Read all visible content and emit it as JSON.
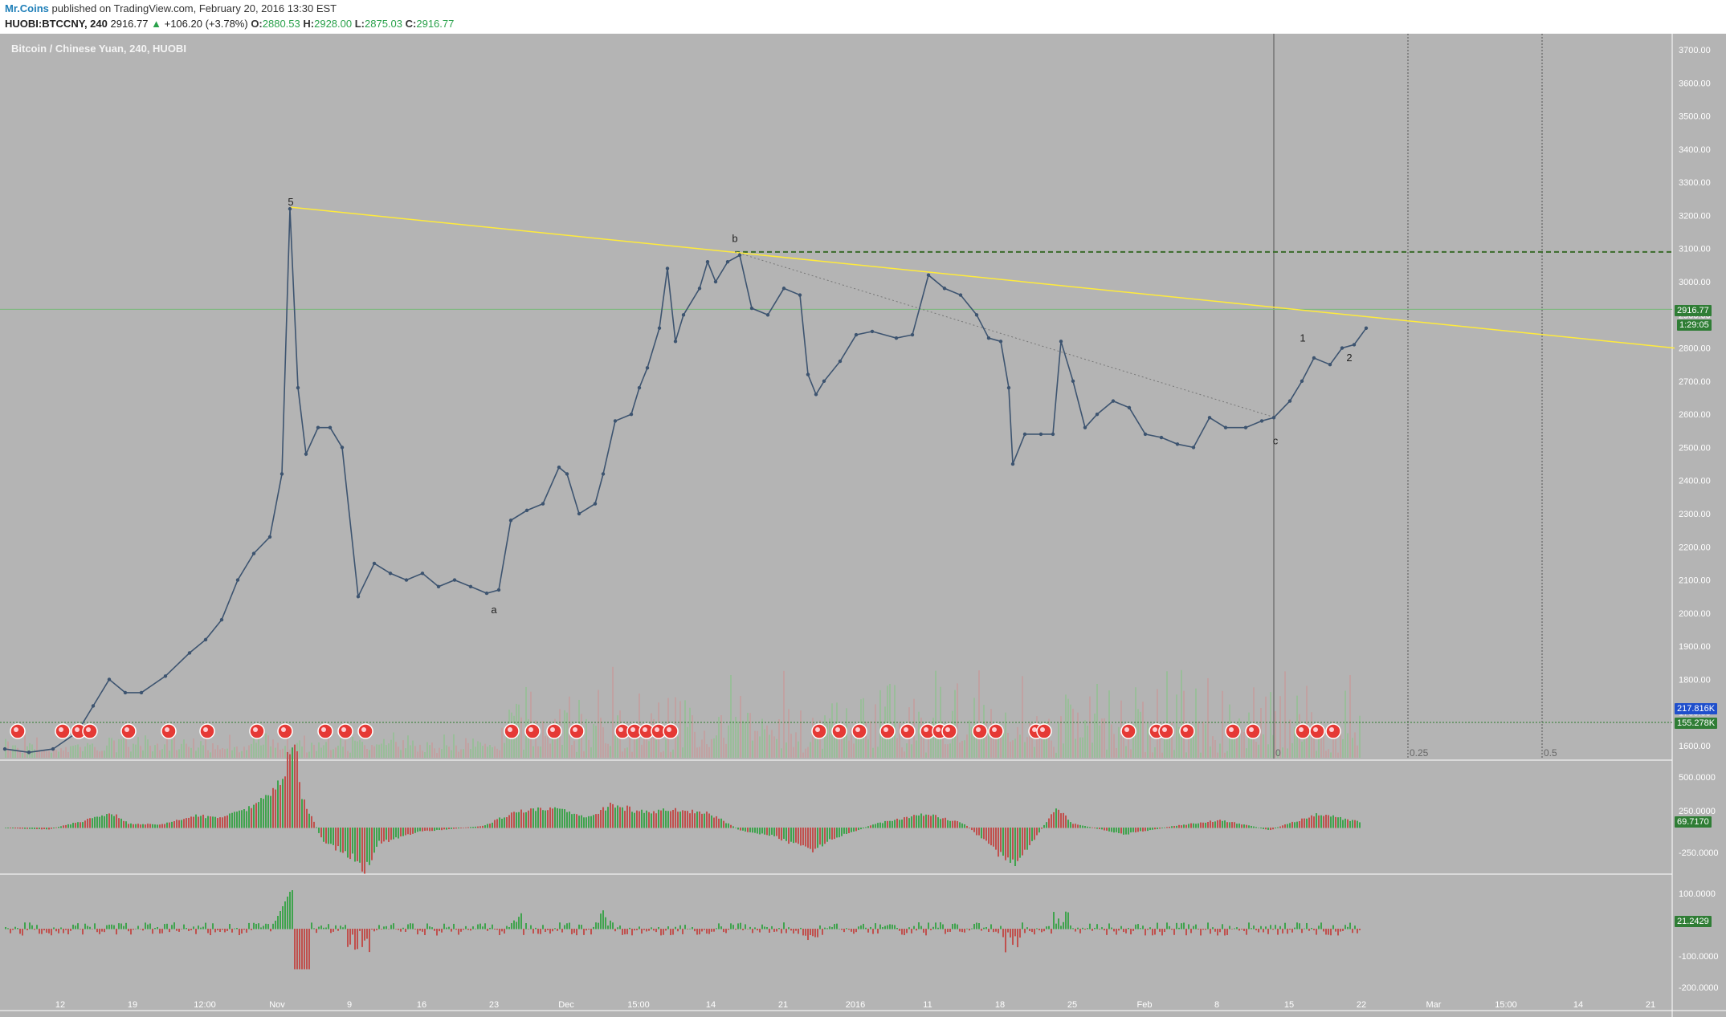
{
  "header": {
    "author": "Mr.Coins",
    "published_text": "published on TradingView.com, February 20, 2016 13:30 EST",
    "symbol": "HUOBI:BTCCNY, 240",
    "last": "2916.77",
    "change": "+106.20 (+3.78%)",
    "o_label": "O:",
    "o_value": "2880.53",
    "h_label": "H:",
    "h_value": "2928.00",
    "l_label": "L:",
    "l_value": "2875.03",
    "c_label": "C:",
    "c_value": "2916.77"
  },
  "panel_title": "Bitcoin / Chinese Yuan, 240, HUOBI",
  "tags": {
    "last_price": "2916.77",
    "countdown": "1:29:05",
    "vol_ma": "217.816K",
    "vol": "155.278K",
    "ind1": "69.7170",
    "ind2": "21.2429"
  },
  "colors": {
    "background": "#b4b4b4",
    "price_line": "#3d5470",
    "trendline": "#ffeb3b",
    "resistance": "#3a6b2a",
    "up": "#4caf50",
    "down": "#c0504d"
  },
  "chart_data": {
    "type": "line",
    "title": "Bitcoin / Chinese Yuan, 240, HUOBI",
    "y_range": [
      1570,
      3760
    ],
    "y_ticks": [
      "3700.00",
      "3600.00",
      "3500.00",
      "3400.00",
      "3300.00",
      "3200.00",
      "3100.00",
      "3000.00",
      "2900.00",
      "2800.00",
      "2700.00",
      "2600.00",
      "2500.00",
      "2400.00",
      "2300.00",
      "2200.00",
      "2100.00",
      "2000.00",
      "1900.00",
      "1800.00",
      "1700.00",
      "1600.00"
    ],
    "x_ticks": [
      "12",
      "19",
      "12:00",
      "Nov",
      "9",
      "16",
      "23",
      "Dec",
      "15:00",
      "14",
      "21",
      "2016",
      "11",
      "18",
      "25",
      "Feb",
      "8",
      "15",
      "22",
      "Mar",
      "15:00",
      "14",
      "21"
    ],
    "series": [
      {
        "points": [
          [
            0,
            1590
          ],
          [
            30,
            1580
          ],
          [
            60,
            1590
          ],
          [
            90,
            1640
          ],
          [
            110,
            1720
          ],
          [
            130,
            1800
          ],
          [
            150,
            1760
          ],
          [
            170,
            1760
          ],
          [
            200,
            1810
          ],
          [
            230,
            1880
          ],
          [
            250,
            1920
          ],
          [
            270,
            1980
          ],
          [
            290,
            2100
          ],
          [
            310,
            2180
          ],
          [
            330,
            2230
          ],
          [
            345,
            2420
          ],
          [
            355,
            3220
          ],
          [
            365,
            2680
          ],
          [
            375,
            2480
          ],
          [
            390,
            2560
          ],
          [
            405,
            2560
          ],
          [
            420,
            2500
          ],
          [
            440,
            2050
          ],
          [
            460,
            2150
          ],
          [
            480,
            2120
          ],
          [
            500,
            2100
          ],
          [
            520,
            2120
          ],
          [
            540,
            2080
          ],
          [
            560,
            2100
          ],
          [
            580,
            2080
          ],
          [
            600,
            2060
          ],
          [
            615,
            2070
          ],
          [
            630,
            2280
          ],
          [
            650,
            2310
          ],
          [
            670,
            2330
          ],
          [
            690,
            2440
          ],
          [
            700,
            2420
          ],
          [
            715,
            2300
          ],
          [
            735,
            2330
          ],
          [
            745,
            2420
          ],
          [
            760,
            2580
          ],
          [
            780,
            2600
          ],
          [
            790,
            2680
          ],
          [
            800,
            2740
          ],
          [
            815,
            2860
          ],
          [
            825,
            3040
          ],
          [
            835,
            2820
          ],
          [
            845,
            2900
          ],
          [
            865,
            2980
          ],
          [
            875,
            3060
          ],
          [
            885,
            3000
          ],
          [
            900,
            3060
          ],
          [
            915,
            3080
          ],
          [
            930,
            2920
          ],
          [
            950,
            2900
          ],
          [
            970,
            2980
          ],
          [
            990,
            2960
          ],
          [
            1000,
            2720
          ],
          [
            1010,
            2660
          ],
          [
            1020,
            2700
          ],
          [
            1040,
            2760
          ],
          [
            1060,
            2840
          ],
          [
            1080,
            2850
          ],
          [
            1110,
            2830
          ],
          [
            1130,
            2840
          ],
          [
            1150,
            3020
          ],
          [
            1170,
            2980
          ],
          [
            1190,
            2960
          ],
          [
            1210,
            2900
          ],
          [
            1225,
            2830
          ],
          [
            1240,
            2820
          ],
          [
            1250,
            2680
          ],
          [
            1255,
            2450
          ],
          [
            1270,
            2540
          ],
          [
            1290,
            2540
          ],
          [
            1305,
            2540
          ],
          [
            1315,
            2820
          ],
          [
            1330,
            2700
          ],
          [
            1345,
            2560
          ],
          [
            1360,
            2600
          ],
          [
            1380,
            2640
          ],
          [
            1400,
            2620
          ],
          [
            1420,
            2540
          ],
          [
            1440,
            2530
          ],
          [
            1460,
            2510
          ],
          [
            1480,
            2500
          ],
          [
            1500,
            2590
          ],
          [
            1520,
            2560
          ],
          [
            1545,
            2560
          ],
          [
            1565,
            2580
          ],
          [
            1580,
            2590
          ],
          [
            1600,
            2640
          ],
          [
            1615,
            2700
          ],
          [
            1630,
            2770
          ],
          [
            1650,
            2750
          ],
          [
            1665,
            2800
          ],
          [
            1680,
            2810
          ],
          [
            1695,
            2860
          ]
        ]
      }
    ],
    "annotations": [
      {
        "label": "5",
        "x": 362,
        "y": 3230
      },
      {
        "label": "a",
        "x": 615,
        "y": 2000
      },
      {
        "label": "b",
        "x": 915,
        "y": 3120
      },
      {
        "label": "c",
        "x": 1588,
        "y": 2510
      },
      {
        "label": "1",
        "x": 1622,
        "y": 2820
      },
      {
        "label": "2",
        "x": 1680,
        "y": 2760
      }
    ],
    "fib_labels": [
      "0",
      "0.25",
      "0.5"
    ],
    "resistance_level": 3090,
    "last_price_level": 2916.77,
    "trendline": [
      [
        362,
        3225
      ],
      [
        2085,
        2800
      ]
    ],
    "indicator1": {
      "ticks": [
        "500.0000",
        "250.0000",
        "-250.0000"
      ],
      "last": "69.7170"
    },
    "indicator2": {
      "ticks": [
        "100.0000",
        "-100.0000",
        "-200.0000"
      ],
      "last": "21.2429"
    }
  }
}
